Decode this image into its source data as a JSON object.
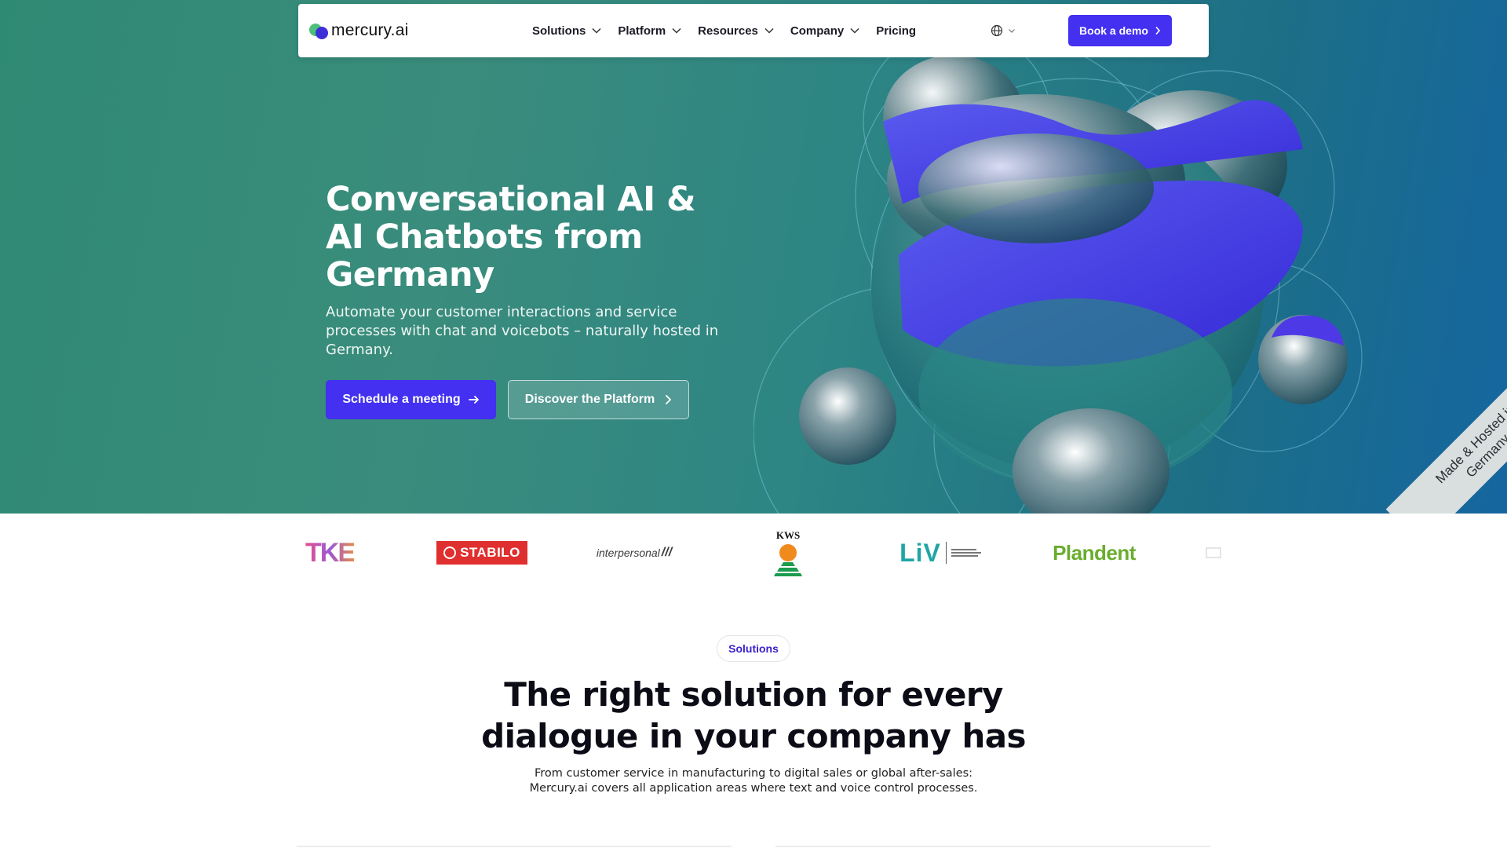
{
  "brand": {
    "name": "mercury.ai"
  },
  "nav": {
    "items": [
      {
        "label": "Solutions",
        "has_dropdown": true
      },
      {
        "label": "Platform",
        "has_dropdown": true
      },
      {
        "label": "Resources",
        "has_dropdown": true
      },
      {
        "label": "Company",
        "has_dropdown": true
      },
      {
        "label": "Pricing",
        "has_dropdown": false
      }
    ],
    "language_icon": "globe-icon",
    "cta_label": "Book a demo"
  },
  "hero": {
    "title_lines": [
      "Conversational AI &",
      "AI Chatbots from",
      "Germany"
    ],
    "subtitle": "Automate your customer interactions and service processes with chat and voicebots – naturally hosted in Germany.",
    "primary_button": "Schedule a meeting",
    "secondary_button": "Discover the Platform",
    "ribbon_lines": [
      "Made & Hosted in",
      "Germany"
    ]
  },
  "client_logos": [
    "TKE",
    "STABILO",
    "interpersonal",
    "KWS",
    "LiV",
    "Plandent"
  ],
  "solutions": {
    "badge": "Solutions",
    "title_lines": [
      "The right solution for every",
      "dialogue in your company has"
    ],
    "subtitle_lines": [
      "From customer service in manufacturing to digital sales or global after-sales:",
      "Mercury.ai covers all application areas where text and voice control processes."
    ]
  },
  "colors": {
    "accent": "#4330f0",
    "hero_gradient_start": "#2f8a74",
    "hero_gradient_end": "#1566a0",
    "badge_text": "#3a22c9"
  }
}
